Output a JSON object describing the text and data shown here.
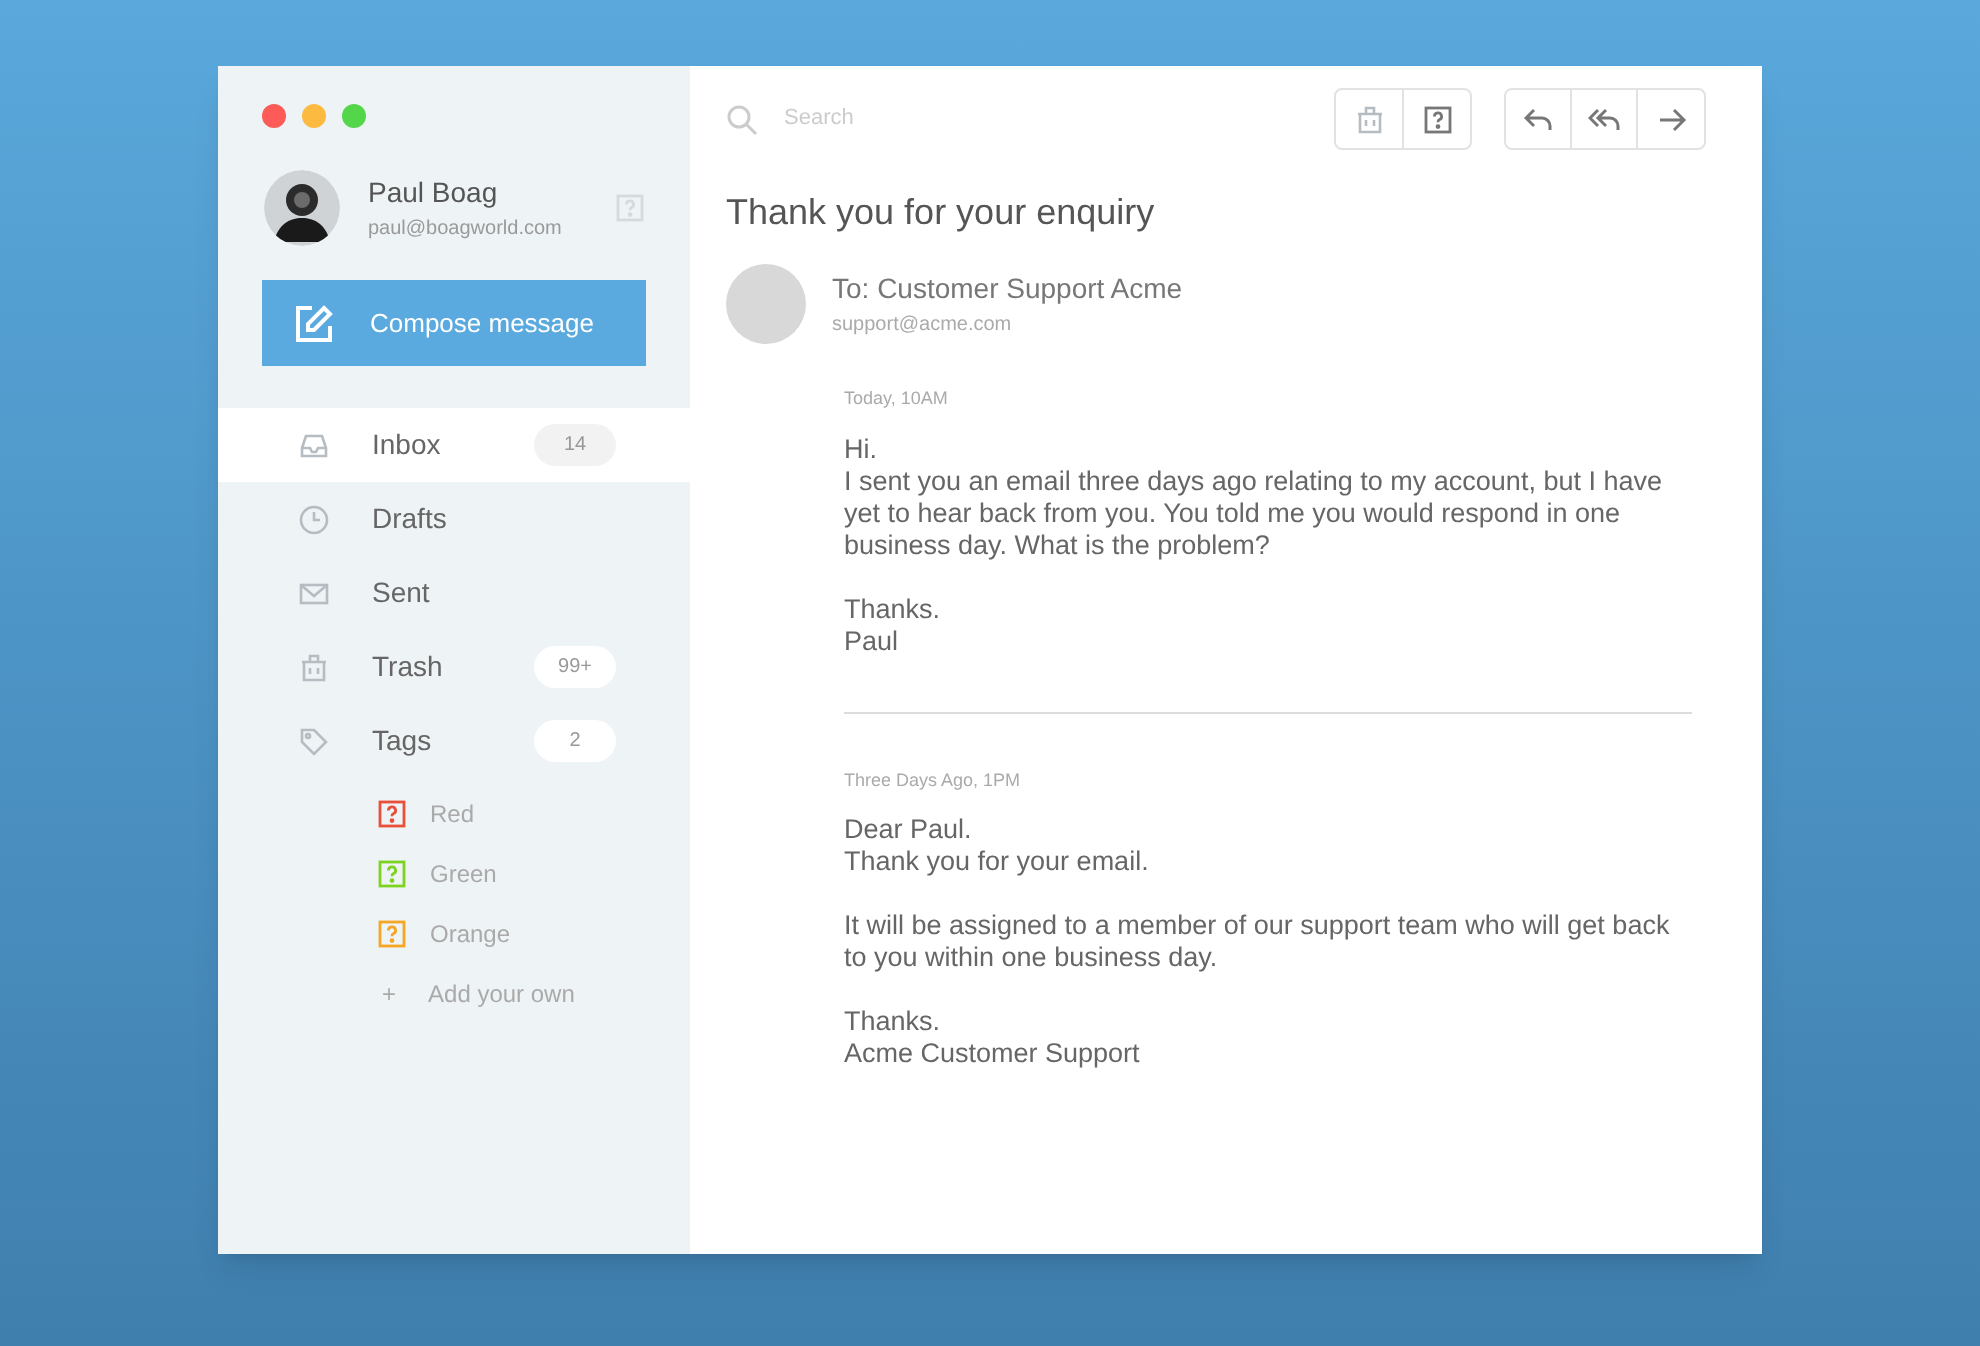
{
  "user": {
    "name": "Paul Boag",
    "email": "paul@boagworld.com"
  },
  "compose": {
    "label": "Compose message"
  },
  "nav": [
    {
      "kind": "inbox",
      "label": "Inbox",
      "count": "14",
      "selected": true
    },
    {
      "kind": "drafts",
      "label": "Drafts",
      "selected": false
    },
    {
      "kind": "sent",
      "label": "Sent",
      "selected": false
    },
    {
      "kind": "trash",
      "label": "Trash",
      "count": "99+",
      "selected": false
    },
    {
      "kind": "tags",
      "label": "Tags",
      "count": "2",
      "selected": false
    }
  ],
  "tags": [
    {
      "label": "Red",
      "color": "#e8503a"
    },
    {
      "label": "Green",
      "color": "#7ed321"
    },
    {
      "label": "Orange",
      "color": "#f5a623"
    }
  ],
  "add_tag": {
    "icon": "+",
    "label": "Add your own"
  },
  "search": {
    "placeholder": "Search"
  },
  "subject": "Thank you for your enquiry",
  "recipient": {
    "to": "To: Customer Support Acme",
    "email": "support@acme.com"
  },
  "messages": [
    {
      "date": "Today, 10AM",
      "paragraphs": [
        [
          "Hi.",
          "I sent you an email three days ago relating to my account, but I have yet to hear back from you. You told me you would respond in one business day. What is the problem?"
        ],
        [
          "Thanks.",
          "Paul"
        ]
      ]
    },
    {
      "date": "Three Days Ago, 1PM",
      "paragraphs": [
        [
          "Dear Paul.",
          "Thank you for your email."
        ],
        [
          "It will be assigned to a member of our support team who will get back to you within one business day."
        ],
        [
          "Thanks.",
          "Acme Customer Support"
        ]
      ]
    }
  ]
}
